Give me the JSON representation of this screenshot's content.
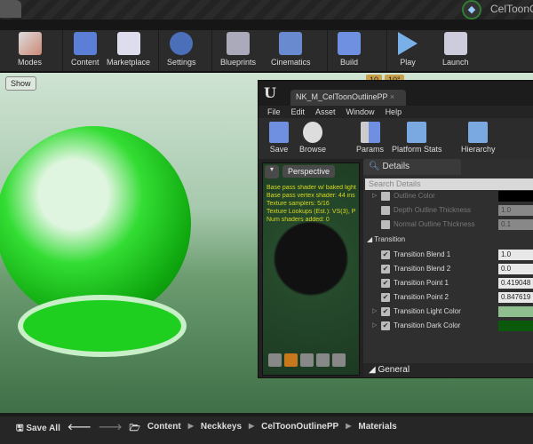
{
  "title_bar": {
    "project_name": "CelToonO"
  },
  "toolbar": {
    "items": [
      {
        "label": "Modes"
      },
      {
        "label": "Content"
      },
      {
        "label": "Marketplace"
      },
      {
        "label": "Settings"
      },
      {
        "label": "Blueprints"
      },
      {
        "label": "Cinematics"
      },
      {
        "label": "Build"
      },
      {
        "label": "Play"
      },
      {
        "label": "Launch"
      }
    ]
  },
  "viewport": {
    "show_label": "Show",
    "grid_snap": "10",
    "rotation_snap": "10°"
  },
  "material_editor": {
    "tab_title": "NK_M_CelToonOutlinePP",
    "menu": [
      "File",
      "Edit",
      "Asset",
      "Window",
      "Help"
    ],
    "tools": [
      {
        "label": "Save"
      },
      {
        "label": "Browse"
      },
      {
        "label": "Params"
      },
      {
        "label": "Platform Stats"
      },
      {
        "label": "Hierarchy"
      }
    ],
    "preview": {
      "mode": "Perspective",
      "stats": [
        "Base pass shader w/ baked light",
        "Base pass vertex shader: 44 ins",
        "Texture samplers: 5/16",
        "Texture Lookups (Est.): VS(3), P",
        "Num shaders added: 0"
      ]
    },
    "details": {
      "tab": "Details",
      "search_placeholder": "Search Details",
      "rows": [
        {
          "label": "Outline Color",
          "value": ""
        },
        {
          "label": "Depth Outline Thickness",
          "value": "1.0"
        },
        {
          "label": "Normal Outline Thickness",
          "value": "0.1"
        }
      ],
      "transition_category": "Transition",
      "transition_rows": [
        {
          "label": "Transition Blend 1",
          "value": "1.0"
        },
        {
          "label": "Transition Blend 2",
          "value": "0.0"
        },
        {
          "label": "Transition Point 1",
          "value": "0.419048"
        },
        {
          "label": "Transition Point 2",
          "value": "0.847619"
        },
        {
          "label": "Transition Light Color",
          "color": "#8fbf8f"
        },
        {
          "label": "Transition Dark Color",
          "color": "#0b5a0b"
        }
      ],
      "general_category": "General"
    }
  },
  "content_browser": {
    "save_all": "Save All",
    "breadcrumb": [
      "Content",
      "Neckkeys",
      "CelToonOutlinePP",
      "Materials"
    ]
  }
}
